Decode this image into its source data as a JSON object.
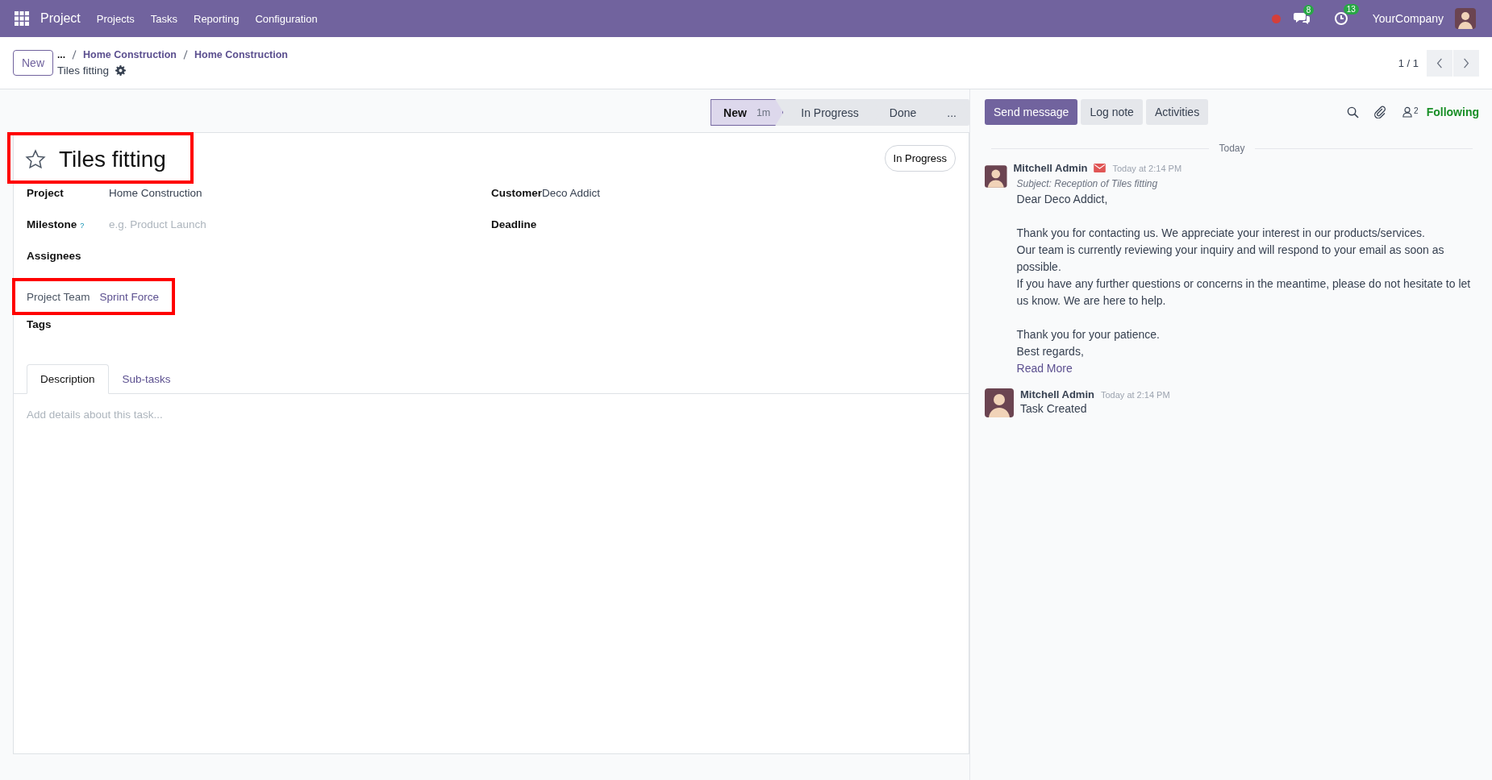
{
  "navbar": {
    "app": "Project",
    "menu": [
      "Projects",
      "Tasks",
      "Reporting",
      "Configuration"
    ],
    "messages_badge": "8",
    "activities_badge": "13",
    "company": "YourCompany",
    "recording": true
  },
  "control_panel": {
    "new_button": "New",
    "breadcrumbs_more": "...",
    "breadcrumbs": [
      "Home Construction",
      "Home Construction"
    ],
    "record": "Tiles fitting",
    "pager": "1 / 1"
  },
  "statusbar": {
    "stages": [
      {
        "label": "New",
        "duration": "1m",
        "selected": true
      },
      {
        "label": "In Progress",
        "selected": false
      },
      {
        "label": "Done",
        "selected": false
      },
      {
        "label": "...",
        "selected": false
      }
    ]
  },
  "form": {
    "title": "Tiles fitting",
    "starred": false,
    "title_highlighted": true,
    "state": "In Progress",
    "left_fields": [
      {
        "label": "Project",
        "value": "Home Construction",
        "kind": "text",
        "highlighted": false
      },
      {
        "label": "Milestone",
        "help": "?",
        "placeholder": "e.g. Product Launch",
        "kind": "placeholder",
        "highlighted": false
      },
      {
        "label": "Assignees",
        "kind": "empty",
        "highlighted": false
      },
      {
        "label": "Project Team",
        "value": "Sprint Force",
        "kind": "link",
        "highlighted": true
      },
      {
        "label": "Tags",
        "kind": "empty",
        "highlighted": false
      }
    ],
    "right_fields": [
      {
        "label": "Customer",
        "value": "Deco Addict",
        "kind": "text"
      },
      {
        "label": "Deadline",
        "kind": "empty"
      }
    ],
    "tabs": [
      {
        "label": "Description",
        "selected": true
      },
      {
        "label": "Sub-tasks",
        "selected": false
      }
    ],
    "description_placeholder": "Add details about this task..."
  },
  "chatter": {
    "buttons": [
      {
        "label": "Send message",
        "selected": true
      },
      {
        "label": "Log note",
        "selected": false
      },
      {
        "label": "Activities",
        "selected": false
      }
    ],
    "followers_count": "2",
    "follow_label": "Following",
    "date_separator": "Today",
    "messages": [
      {
        "author": "Mitchell Admin",
        "email": true,
        "time": "Today at 2:14 PM",
        "subject": "Subject: Reception of Tiles fitting",
        "paragraphs": [
          [
            "Dear Deco Addict,"
          ],
          [
            "Thank you for contacting us. We appreciate your interest in our products/services.",
            "Our team is currently reviewing your inquiry and will respond to your email as soon as possible.",
            "If you have any further questions or concerns in the meantime, please do not hesitate to let us know. We are here to help."
          ],
          [
            "Thank you for your patience.",
            "Best regards,"
          ]
        ],
        "read_more": "Read More"
      },
      {
        "author": "Mitchell Admin",
        "email": false,
        "time": "Today at 2:14 PM",
        "paragraphs": [
          [
            "Task Created"
          ]
        ]
      }
    ]
  }
}
